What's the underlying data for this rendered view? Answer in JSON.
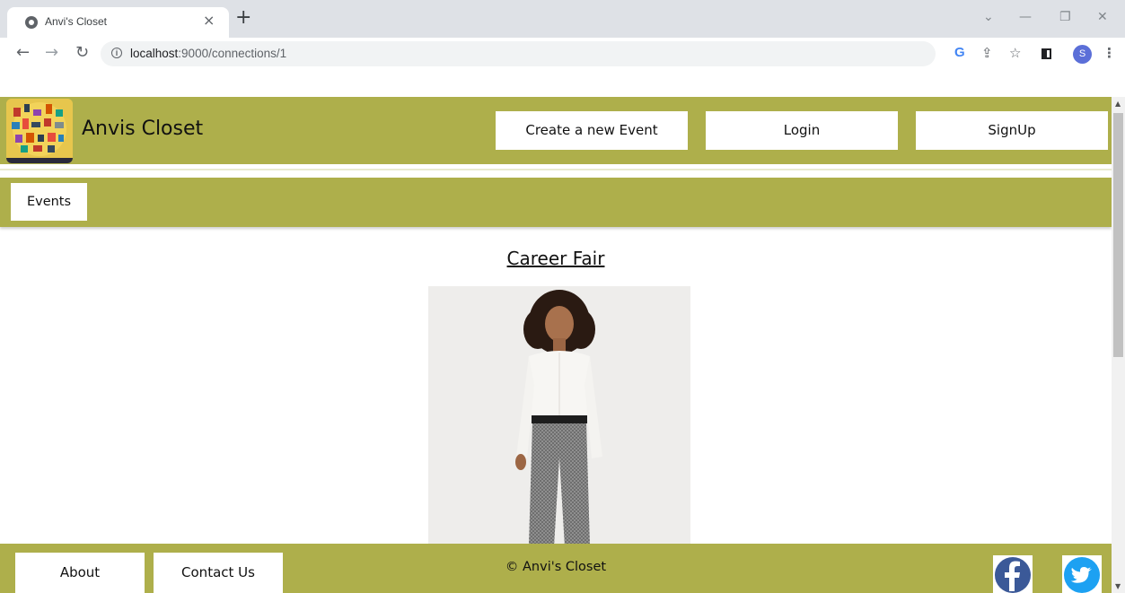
{
  "browser": {
    "tab_title": "Anvi's Closet",
    "tab_close": "×",
    "new_tab": "+",
    "url_host": "localhost",
    "url_path": ":9000/connections/1",
    "avatar_letter": "S",
    "icons": [
      "globe-icon",
      "close-icon",
      "plus-icon",
      "back-icon",
      "forward-icon",
      "reload-icon",
      "info-icon",
      "google-icon",
      "share-icon",
      "star-icon",
      "side-panel-icon",
      "profile-avatar",
      "kebab-menu-icon"
    ]
  },
  "header": {
    "site_title": "Anvis Closet",
    "buttons": {
      "create_event": "Create a new Event",
      "login": "Login",
      "signup": "SignUp"
    }
  },
  "nav": {
    "events_label": "Events"
  },
  "event": {
    "title": "Career Fair"
  },
  "footer": {
    "about_label": "About",
    "contact_label": "Contact Us",
    "copyright": "© Anvi's Closet",
    "social": [
      "facebook-icon",
      "twitter-icon"
    ]
  },
  "colors": {
    "brand_olive": "#aeaf4b",
    "facebook_blue": "#3b5998",
    "twitter_blue": "#1da1f2"
  }
}
